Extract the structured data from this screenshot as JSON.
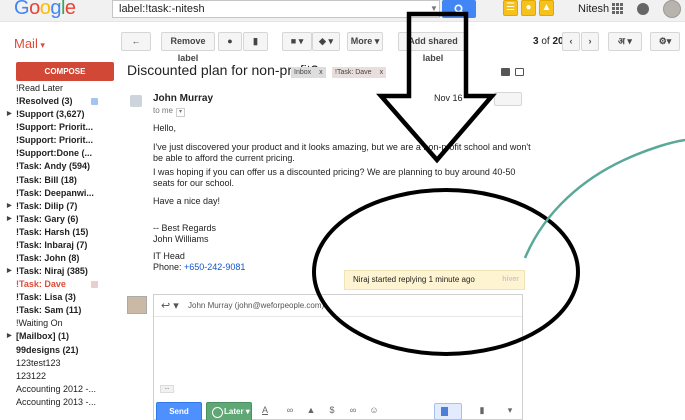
{
  "topbar": {
    "logo": "Google",
    "search_value": "label:!task:-nitesh",
    "user_name": "Nitesh"
  },
  "toolbar": {
    "app_label": "Mail",
    "remove_label": "Remove label",
    "more_label": "More",
    "add_shared_label": "Add shared label",
    "pager_current": "3",
    "pager_of": "of",
    "pager_total": "20",
    "lang_label": "अ"
  },
  "sidebar": {
    "compose_label": "COMPOSE",
    "labels": [
      {
        "text": "!Read Later",
        "style": "plain",
        "expander": false,
        "swatch": ""
      },
      {
        "text": "!Resolved (3)",
        "style": "bold",
        "expander": false,
        "swatch": "#a4c2f4"
      },
      {
        "text": "!Support (3,627)",
        "style": "bold",
        "expander": true,
        "swatch": ""
      },
      {
        "text": "!Support: Priorit...",
        "style": "bold",
        "expander": false,
        "swatch": ""
      },
      {
        "text": "!Support: Priorit...",
        "style": "bold",
        "expander": false,
        "swatch": ""
      },
      {
        "text": "!Support:Done (...",
        "style": "bold",
        "expander": false,
        "swatch": ""
      },
      {
        "text": "!Task: Andy (594)",
        "style": "bold",
        "expander": false,
        "swatch": ""
      },
      {
        "text": "!Task: Bill (18)",
        "style": "bold",
        "expander": false,
        "swatch": ""
      },
      {
        "text": "!Task: Deepanwi...",
        "style": "bold",
        "expander": false,
        "swatch": ""
      },
      {
        "text": "!Task: Dilip (7)",
        "style": "bold",
        "expander": true,
        "swatch": ""
      },
      {
        "text": "!Task: Gary (6)",
        "style": "bold",
        "expander": true,
        "swatch": ""
      },
      {
        "text": "!Task: Harsh (15)",
        "style": "bold",
        "expander": false,
        "swatch": ""
      },
      {
        "text": "!Task: Inbaraj (7)",
        "style": "bold",
        "expander": false,
        "swatch": ""
      },
      {
        "text": "!Task: John (8)",
        "style": "bold",
        "expander": false,
        "swatch": ""
      },
      {
        "text": "!Task: Niraj (385)",
        "style": "bold",
        "expander": true,
        "swatch": ""
      },
      {
        "text": "!Task: Dave",
        "style": "sel",
        "expander": false,
        "swatch": "#e6cfcf"
      },
      {
        "text": "!Task: Lisa (3)",
        "style": "bold",
        "expander": false,
        "swatch": ""
      },
      {
        "text": "!Task: Sam (11)",
        "style": "bold",
        "expander": false,
        "swatch": ""
      },
      {
        "text": "!Waiting On",
        "style": "plain",
        "expander": false,
        "swatch": ""
      },
      {
        "text": "[Mailbox] (1)",
        "style": "bold",
        "expander": true,
        "swatch": ""
      },
      {
        "text": "99designs (21)",
        "style": "bold",
        "expander": false,
        "swatch": ""
      },
      {
        "text": "123test123",
        "style": "plain",
        "expander": false,
        "swatch": ""
      },
      {
        "text": "123122",
        "style": "plain",
        "expander": false,
        "swatch": ""
      },
      {
        "text": "Accounting 2012 -...",
        "style": "plain",
        "expander": false,
        "swatch": ""
      },
      {
        "text": "Accounting 2013 -...",
        "style": "plain",
        "expander": false,
        "swatch": ""
      }
    ]
  },
  "conversation": {
    "subject": "Discounted plan for non-profit?",
    "chips": [
      {
        "label": "Inbox",
        "close": "x"
      },
      {
        "label": "!Task: Dave",
        "close": "x"
      }
    ],
    "message": {
      "sender": "John Murray",
      "to_me": "to me",
      "date": "Nov 16",
      "lines": [
        "Hello,",
        "I've just discovered your product and it looks amazing, but we are a non-profit school and won't",
        "be able to afford the current pricing.",
        "I was hoping if you can offer us a discounted pricing? We are planning to buy around 40-50",
        "seats for our school.",
        "Have a nice day!",
        "-- Best Regards",
        "John Williams",
        "IT Head",
        "Phone: ",
        "+650-242-9081"
      ]
    },
    "typing_notice": "Niraj started replying 1 minute ago",
    "hiver_badge": "hiver"
  },
  "reply": {
    "to_text": "John Murray (john@weforpeople.com)",
    "dots": "...",
    "send_label": "Send",
    "later_label": "Later"
  },
  "annotation": {
    "arrow_color": "#000000",
    "ellipse_color": "#000000",
    "curve_color": "#5aa89a"
  }
}
